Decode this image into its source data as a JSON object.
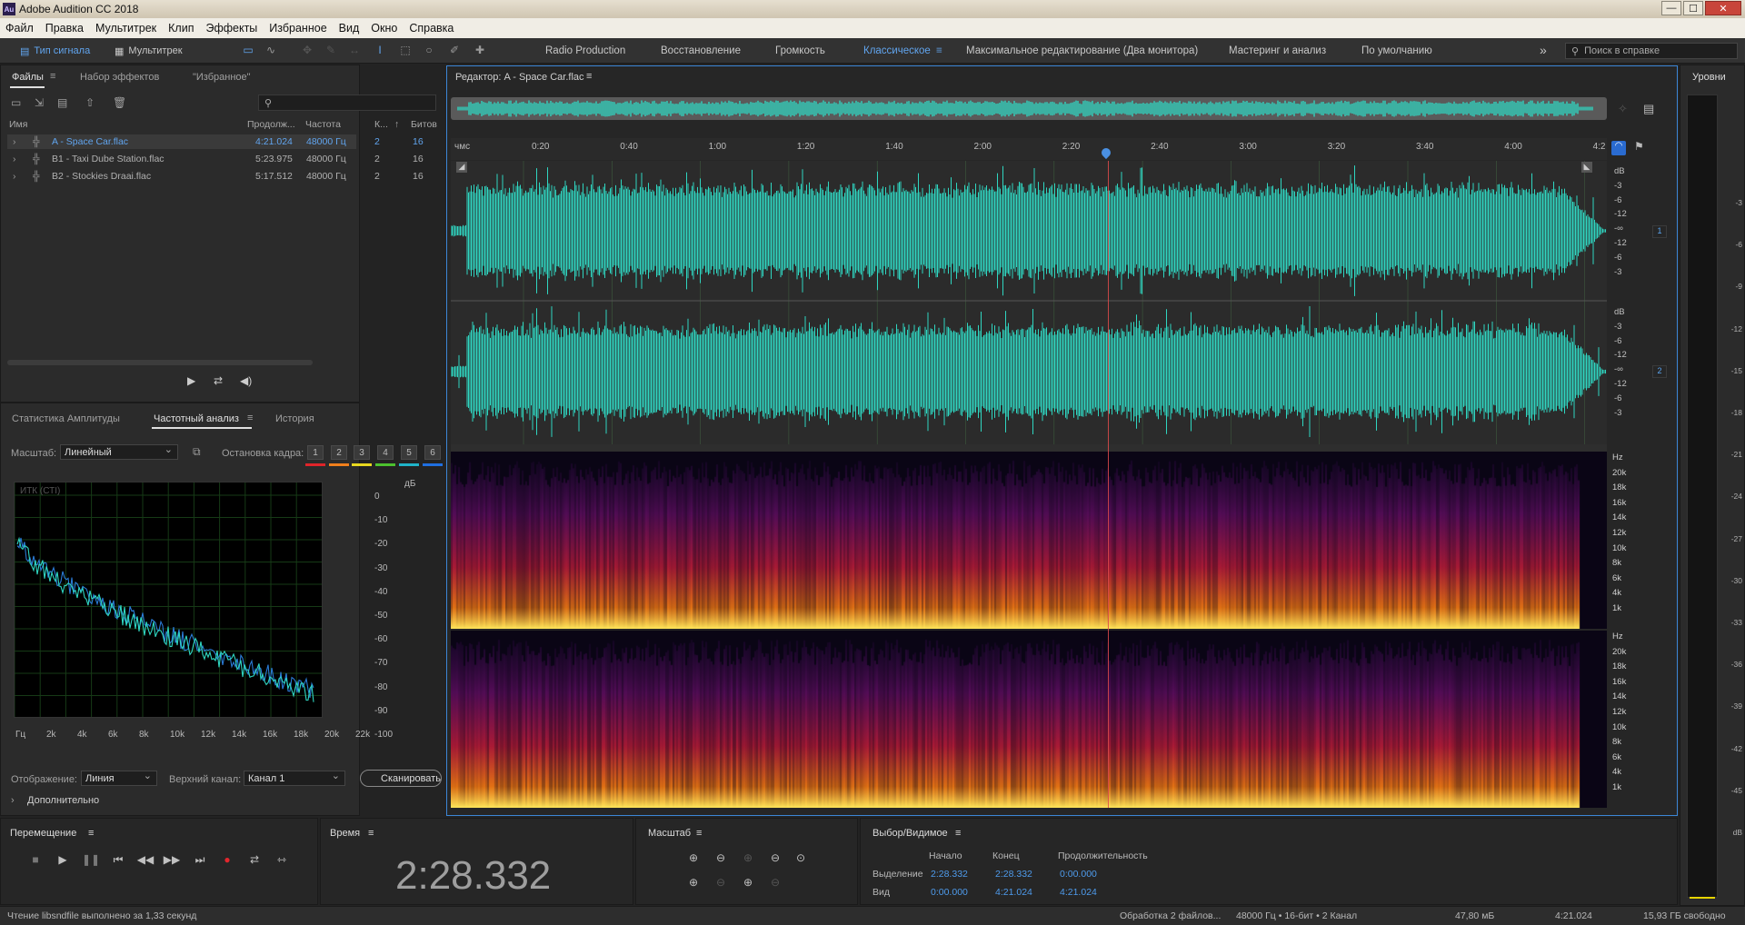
{
  "window": {
    "title": "Adobe Audition CC 2018",
    "app_icon": "Au",
    "controls": [
      "—",
      "☐",
      "✕"
    ]
  },
  "menu": [
    "Файл",
    "Правка",
    "Мультитрек",
    "Клип",
    "Эффекты",
    "Избранное",
    "Вид",
    "Окно",
    "Справка"
  ],
  "toolbar": {
    "waveform_tab": "Тип сигнала",
    "multitrack_tab": "Мультитрек"
  },
  "workspaces": [
    "Radio Production",
    "Восстановление",
    "Громкость",
    "Классическое",
    "Максимальное редактирование (Два монитора)",
    "Мастеринг и анализ",
    "По умолчанию"
  ],
  "active_workspace": "Классическое",
  "help_search": {
    "placeholder": "Поиск в справке"
  },
  "files_panel": {
    "tabs": [
      "Файлы",
      "Набор эффектов",
      "\"Избранное\""
    ],
    "columns": [
      "Имя",
      "Продолж...",
      "Частота",
      "К...",
      "Битов"
    ],
    "rows": [
      {
        "name": "A - Space Car.flac",
        "duration": "4:21.024",
        "rate": "48000 Гц",
        "ch": "2",
        "bits": "16",
        "selected": true
      },
      {
        "name": "B1 - Taxi Dube Station.flac",
        "duration": "5:23.975",
        "rate": "48000 Гц",
        "ch": "2",
        "bits": "16",
        "selected": false
      },
      {
        "name": "B2 - Stockies Draai.flac",
        "duration": "5:17.512",
        "rate": "48000 Гц",
        "ch": "2",
        "bits": "16",
        "selected": false
      }
    ]
  },
  "analysis_panel": {
    "tabs": [
      "Статистика Амплитуды",
      "Частотный анализ",
      "История"
    ],
    "scale_label": "Масштаб:",
    "scale_value": "Линейный",
    "freeze_label": "Остановка кадра:",
    "freeze_numbers": [
      "1",
      "2",
      "3",
      "4",
      "5",
      "6"
    ],
    "freeze_colors": [
      "#e0242a",
      "#f07f1c",
      "#e8d81f",
      "#4cc12e",
      "#1fb3c8",
      "#1f6fe0"
    ],
    "plot_label": "ИТК (СТI)",
    "y_unit": "дБ",
    "y_ticks": [
      "0",
      "-10",
      "-20",
      "-30",
      "-40",
      "-50",
      "-60",
      "-70",
      "-80",
      "-90",
      "-100"
    ],
    "x_ticks": [
      "Гц",
      "2k",
      "4k",
      "6k",
      "8k",
      "10k",
      "12k",
      "14k",
      "16k",
      "18k",
      "20k",
      "22k"
    ],
    "display_label": "Отображение:",
    "display_value": "Линия",
    "channel_label": "Верхний канал:",
    "channel_value": "Канал 1",
    "scan_button": "Сканировать",
    "advanced": "Дополнительно"
  },
  "editor": {
    "title": "Редактор: A - Space Car.flac",
    "timeline_unit": "чмс",
    "timeline": [
      "0:20",
      "0:40",
      "1:00",
      "1:20",
      "1:40",
      "2:00",
      "2:20",
      "2:40",
      "3:00",
      "3:20",
      "3:40",
      "4:00",
      "4:2"
    ],
    "playhead_time": "2:28.332",
    "db_labels_ch": [
      "dB",
      "-3",
      "-6",
      "-12",
      "-∞",
      "-12",
      "-6",
      "-3"
    ],
    "channels": [
      "1",
      "2"
    ],
    "hz_labels": [
      "Hz",
      "20k",
      "18k",
      "16k",
      "14k",
      "12k",
      "10k",
      "8k",
      "6k",
      "4k",
      "1k"
    ],
    "waveform_color": "#2fd6c1"
  },
  "levels": {
    "title": "Уровни",
    "ticks": [
      "-3",
      "-6",
      "-9",
      "-12",
      "-15",
      "-18",
      "-21",
      "-24",
      "-27",
      "-30",
      "-33",
      "-36",
      "-39",
      "-42",
      "-45",
      "dB"
    ]
  },
  "transport": {
    "title": "Перемещение",
    "buttons": [
      "■",
      "▶",
      "❚❚",
      "⏮",
      "◀◀",
      "▶▶",
      "⏭",
      "●",
      "⇄",
      "⇿"
    ]
  },
  "time": {
    "title": "Время",
    "value": "2:28.332"
  },
  "zoom": {
    "title": "Масштаб"
  },
  "selection": {
    "title": "Выбор/Видимое",
    "headers": [
      "Начало",
      "Конец",
      "Продолжительность"
    ],
    "rows": [
      {
        "label": "Выделение",
        "start": "2:28.332",
        "end": "2:28.332",
        "duration": "0:00.000"
      },
      {
        "label": "Вид",
        "start": "0:00.000",
        "end": "4:21.024",
        "duration": "4:21.024"
      }
    ]
  },
  "status": {
    "left": "Чтение libsndfile выполнено за 1,33 секунд",
    "processing": "Обработка 2 файлов...",
    "format": "48000 Гц • 16-бит • 2 Канал",
    "size": "47,80 мБ",
    "duration": "4:21.024",
    "free": "15,93 ГБ свободно"
  }
}
